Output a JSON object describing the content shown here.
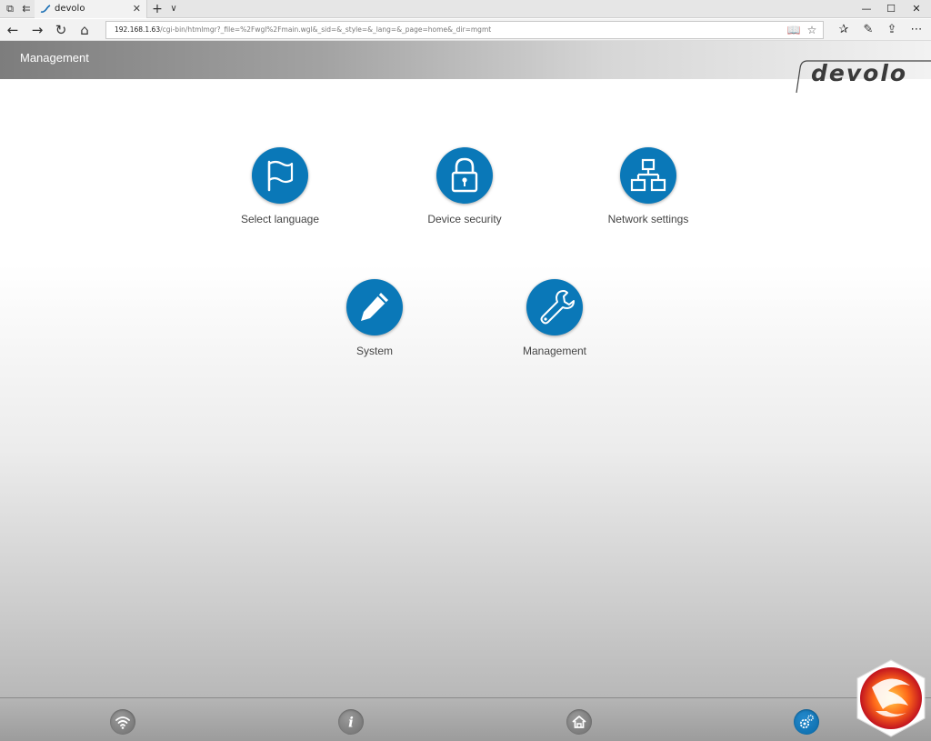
{
  "browser": {
    "tab_title": "devolo",
    "address_host": "192.168.1.63",
    "address_path": "/cgi-bin/htmlmgr?_file=%2Fwgl%2Fmain.wgl&_sid=&_style=&_lang=&_page=home&_dir=mgmt",
    "new_tab_glyph": "+",
    "tab_list_glyph": "∨"
  },
  "header": {
    "title": "Management",
    "logo_text": "devolo"
  },
  "tiles": [
    {
      "label": "Select language",
      "icon": "flag-icon"
    },
    {
      "label": "Device security",
      "icon": "lock-icon"
    },
    {
      "label": "Network settings",
      "icon": "network-icon"
    },
    {
      "label": "System",
      "icon": "pencil-icon"
    },
    {
      "label": "Management",
      "icon": "wrench-icon"
    }
  ],
  "footer": {
    "buttons": [
      {
        "icon": "wifi-icon",
        "active": false
      },
      {
        "icon": "info-icon",
        "active": false
      },
      {
        "icon": "home-icon",
        "active": false
      },
      {
        "icon": "gear-icon",
        "active": true
      }
    ],
    "info_glyph": "i"
  },
  "colors": {
    "accent": "#0a78b8",
    "footer_active": "#1a7fc2",
    "footer_inactive": "#7a7a7a"
  }
}
